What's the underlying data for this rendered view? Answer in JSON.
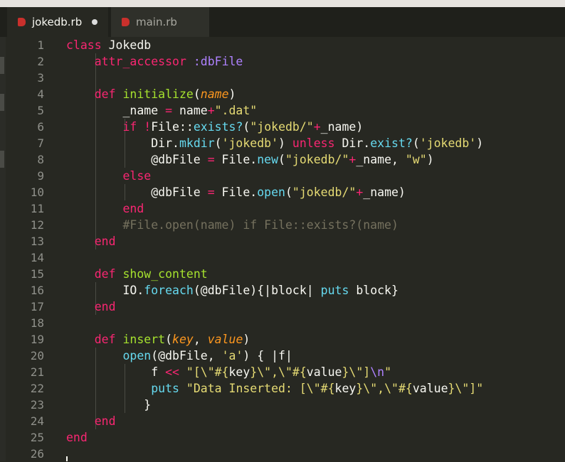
{
  "tabs": [
    {
      "label": "jokedb.rb",
      "active": true,
      "modified": true,
      "icon": "ruby-file-icon"
    },
    {
      "label": "main.rb",
      "active": false,
      "modified": false,
      "icon": "ruby-file-icon"
    }
  ],
  "colors": {
    "background": "#272822",
    "keyword": "#f92672",
    "function": "#a6e22e",
    "string": "#e6db74",
    "comment": "#75715e",
    "builtin": "#66d9ef",
    "parameter": "#fd971f"
  },
  "line_numbers": [
    "1",
    "2",
    "3",
    "4",
    "5",
    "6",
    "7",
    "8",
    "9",
    "10",
    "11",
    "12",
    "13",
    "14",
    "15",
    "16",
    "17",
    "18",
    "19",
    "20",
    "21",
    "22",
    "23",
    "24",
    "25",
    "26"
  ],
  "lines": [
    [
      [
        "k",
        "class"
      ],
      [
        "t",
        " Jokedb"
      ]
    ],
    [
      [
        "t",
        "    "
      ],
      [
        "k",
        "attr_accessor"
      ],
      [
        "t",
        " "
      ],
      [
        "sym",
        ":dbFile"
      ]
    ],
    [],
    [
      [
        "t",
        "    "
      ],
      [
        "k",
        "def"
      ],
      [
        "t",
        " "
      ],
      [
        "f",
        "initialize"
      ],
      [
        "t",
        "("
      ],
      [
        "p",
        "name"
      ],
      [
        "t",
        ")"
      ]
    ],
    [
      [
        "t",
        "        _name "
      ],
      [
        "k",
        "="
      ],
      [
        "t",
        " name"
      ],
      [
        "k",
        "+"
      ],
      [
        "s",
        "\".dat\""
      ]
    ],
    [
      [
        "t",
        "        "
      ],
      [
        "k",
        "if"
      ],
      [
        "t",
        " "
      ],
      [
        "k",
        "!"
      ],
      [
        "t",
        "File::"
      ],
      [
        "b",
        "exists?"
      ],
      [
        "t",
        "("
      ],
      [
        "s",
        "\"jokedb/\""
      ],
      [
        "k",
        "+"
      ],
      [
        "t",
        "_name)"
      ]
    ],
    [
      [
        "t",
        "            Dir."
      ],
      [
        "b",
        "mkdir"
      ],
      [
        "t",
        "("
      ],
      [
        "s",
        "'jokedb'"
      ],
      [
        "t",
        ") "
      ],
      [
        "k",
        "unless"
      ],
      [
        "t",
        " Dir."
      ],
      [
        "b",
        "exist?"
      ],
      [
        "t",
        "("
      ],
      [
        "s",
        "'jokedb'"
      ],
      [
        "t",
        ")"
      ]
    ],
    [
      [
        "t",
        "            @dbFile "
      ],
      [
        "k",
        "="
      ],
      [
        "t",
        " File."
      ],
      [
        "b",
        "new"
      ],
      [
        "t",
        "("
      ],
      [
        "s",
        "\"jokedb/\""
      ],
      [
        "k",
        "+"
      ],
      [
        "t",
        "_name, "
      ],
      [
        "s",
        "\"w\""
      ],
      [
        "t",
        ")"
      ]
    ],
    [
      [
        "t",
        "        "
      ],
      [
        "k",
        "else"
      ]
    ],
    [
      [
        "t",
        "            @dbFile "
      ],
      [
        "k",
        "="
      ],
      [
        "t",
        " File."
      ],
      [
        "b",
        "open"
      ],
      [
        "t",
        "("
      ],
      [
        "s",
        "\"jokedb/\""
      ],
      [
        "k",
        "+"
      ],
      [
        "t",
        "_name)"
      ]
    ],
    [
      [
        "t",
        "        "
      ],
      [
        "k",
        "end"
      ]
    ],
    [
      [
        "t",
        "        "
      ],
      [
        "c",
        "#File.open(name) if File::exists?(name)"
      ]
    ],
    [
      [
        "t",
        "    "
      ],
      [
        "k",
        "end"
      ]
    ],
    [],
    [
      [
        "t",
        "    "
      ],
      [
        "k",
        "def"
      ],
      [
        "t",
        " "
      ],
      [
        "f",
        "show_content"
      ]
    ],
    [
      [
        "t",
        "        IO."
      ],
      [
        "b",
        "foreach"
      ],
      [
        "t",
        "(@dbFile){|block| "
      ],
      [
        "b",
        "puts"
      ],
      [
        "t",
        " block}"
      ]
    ],
    [
      [
        "t",
        "    "
      ],
      [
        "k",
        "end"
      ]
    ],
    [],
    [
      [
        "t",
        "    "
      ],
      [
        "k",
        "def"
      ],
      [
        "t",
        " "
      ],
      [
        "f",
        "insert"
      ],
      [
        "t",
        "("
      ],
      [
        "p",
        "key"
      ],
      [
        "t",
        ", "
      ],
      [
        "p",
        "value"
      ],
      [
        "t",
        ")"
      ]
    ],
    [
      [
        "t",
        "        "
      ],
      [
        "b",
        "open"
      ],
      [
        "t",
        "(@dbFile, "
      ],
      [
        "s",
        "'a'"
      ],
      [
        "t",
        ") { |f|"
      ]
    ],
    [
      [
        "t",
        "            f "
      ],
      [
        "k",
        "<<"
      ],
      [
        "t",
        " "
      ],
      [
        "s",
        "\"[\\\"#{"
      ],
      [
        "t",
        "key"
      ],
      [
        "s",
        "}\\\",\\\"#{"
      ],
      [
        "t",
        "value"
      ],
      [
        "s",
        "}\\\"]"
      ],
      [
        "e",
        "\\n"
      ],
      [
        "s",
        "\""
      ]
    ],
    [
      [
        "t",
        "            "
      ],
      [
        "b",
        "puts"
      ],
      [
        "t",
        " "
      ],
      [
        "s",
        "\"Data Inserted: [\\\"#{"
      ],
      [
        "t",
        "key"
      ],
      [
        "s",
        "}\\\",\\\"#{"
      ],
      [
        "t",
        "value"
      ],
      [
        "s",
        "}\\\"]\""
      ]
    ],
    [
      [
        "t",
        "           }"
      ]
    ],
    [
      [
        "t",
        "    "
      ],
      [
        "k",
        "end"
      ]
    ],
    [
      [
        "k",
        "end"
      ]
    ],
    []
  ]
}
